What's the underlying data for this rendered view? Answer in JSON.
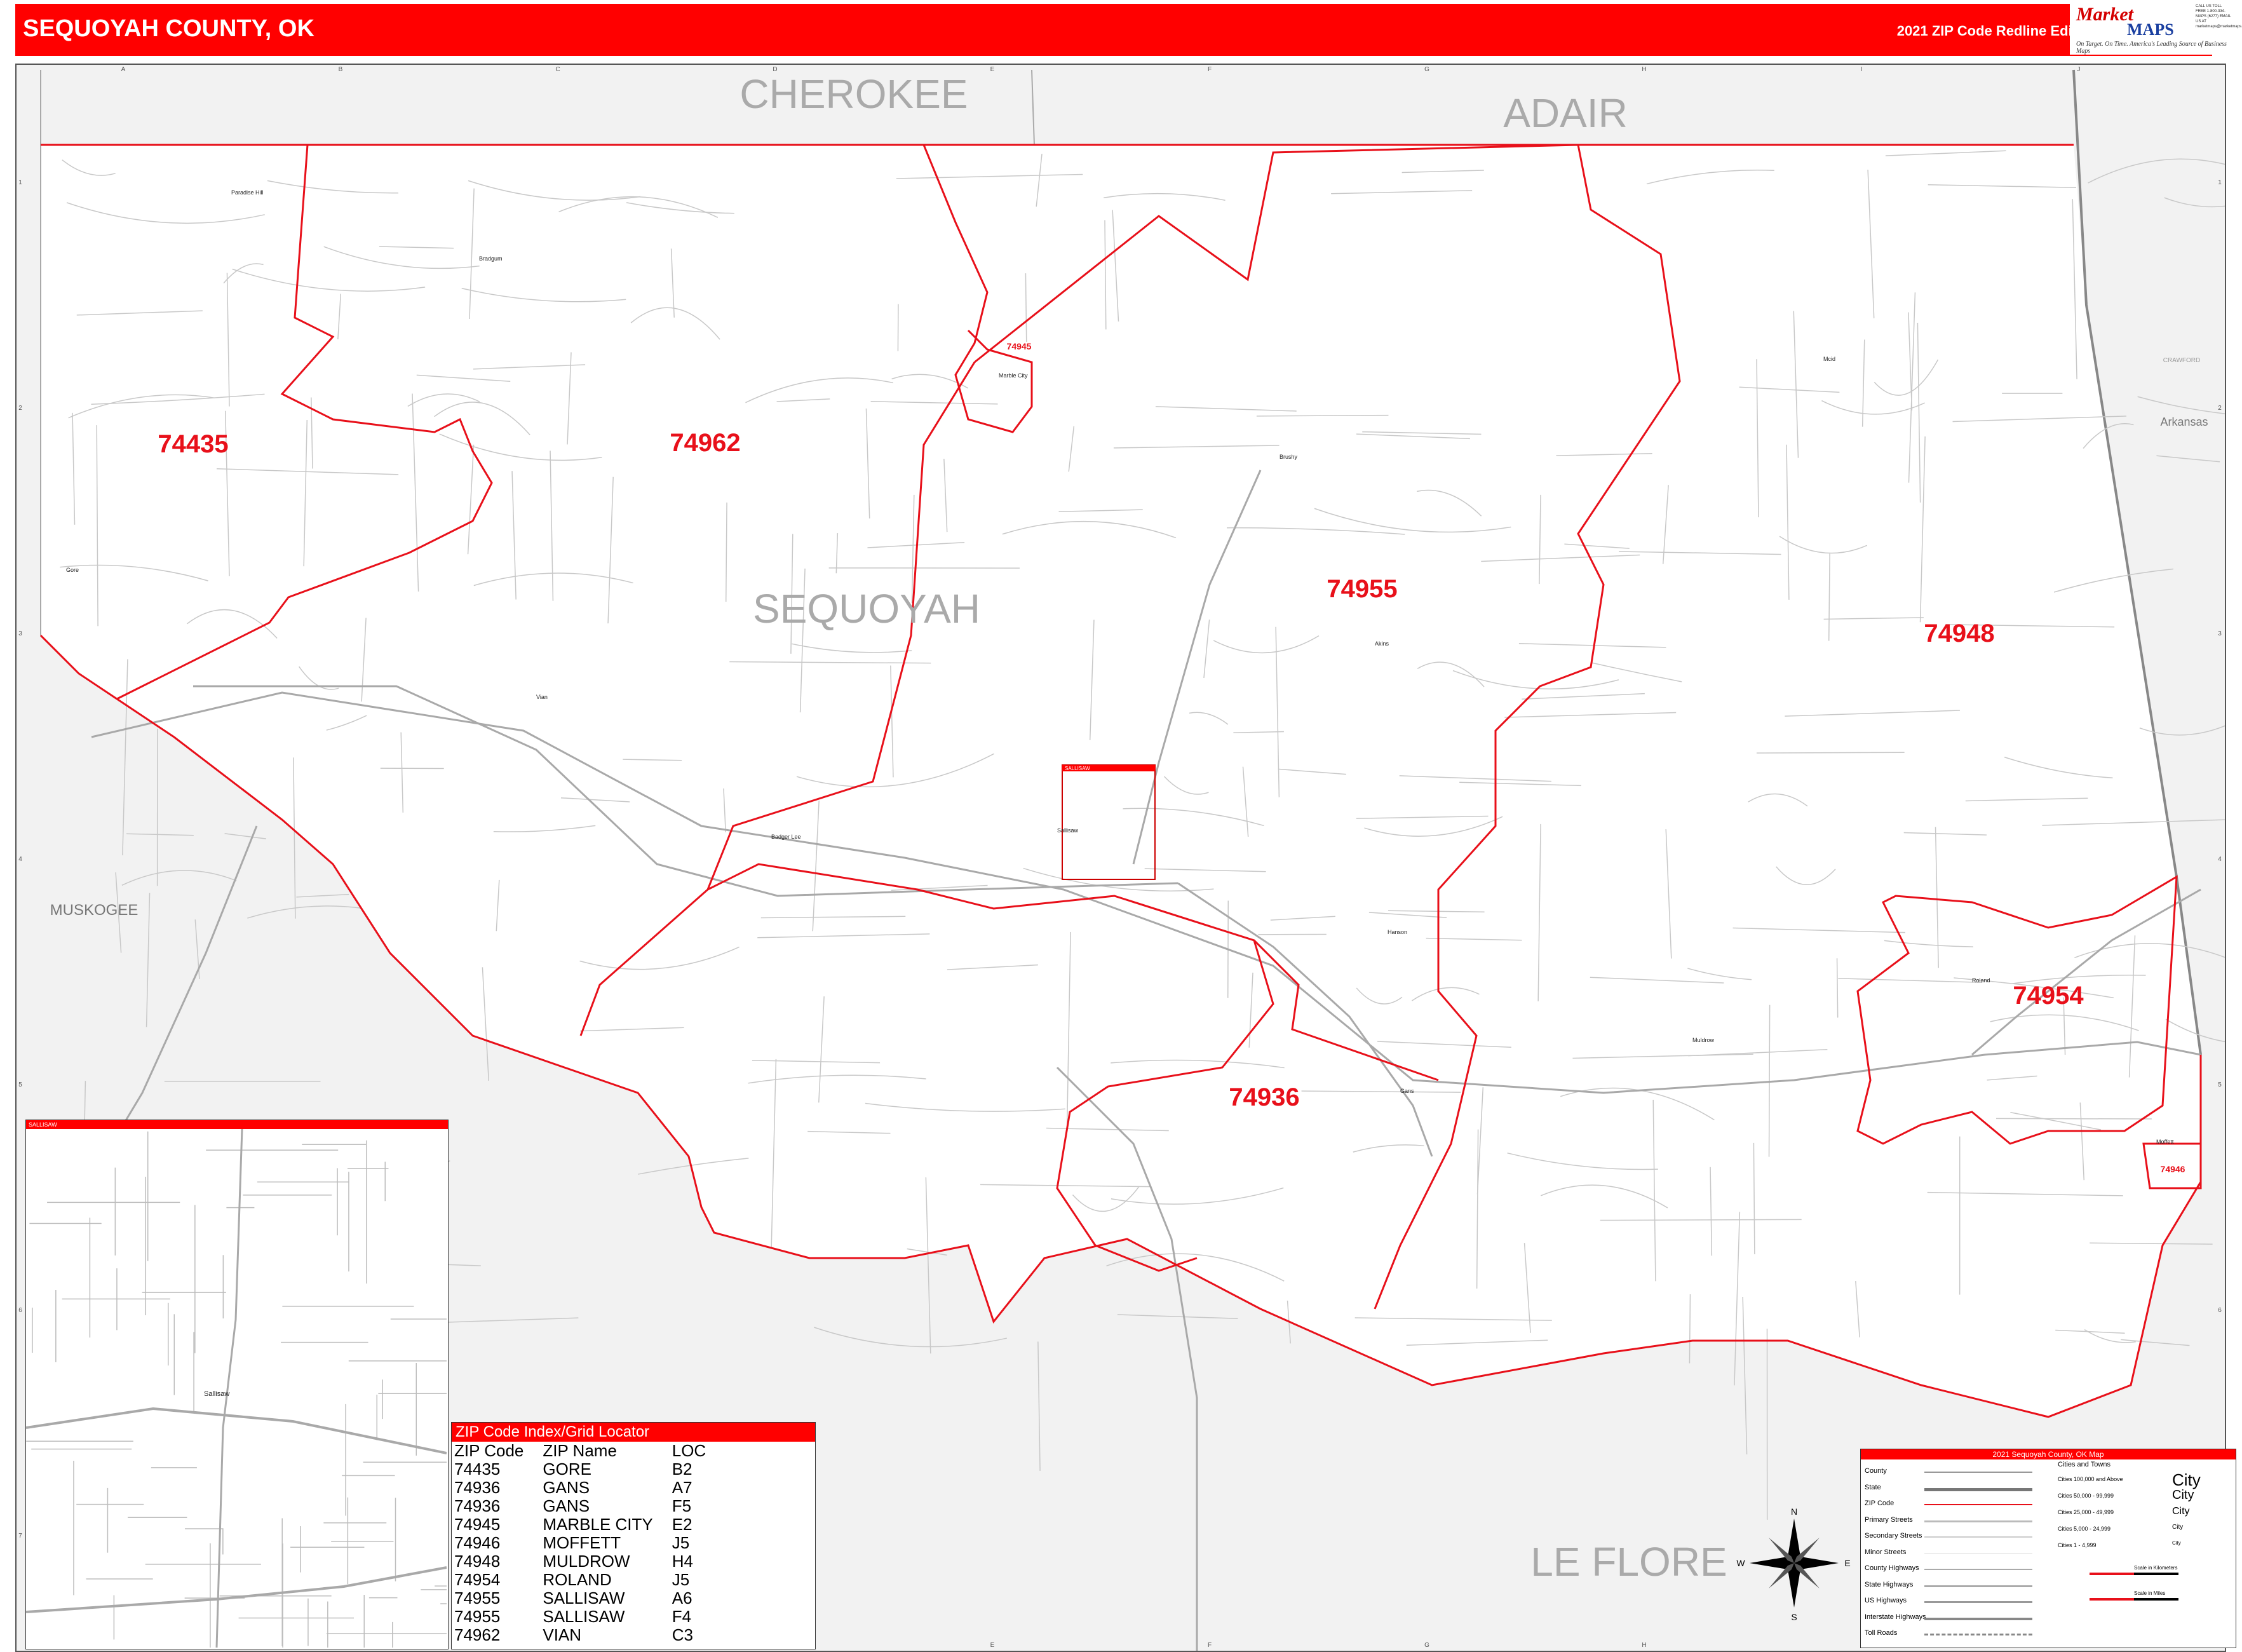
{
  "header": {
    "title": "SEQUOYAH COUNTY, OK",
    "edition": "2021 ZIP Code Redline Edition",
    "logo_line1": "Market",
    "logo_line2": "MAPS",
    "logo_tagline": "On Target. On Time. America's Leading Source of Business Maps",
    "logo_contact": "CALL US TOLL FREE 1-800-334-MAPS (6277) EMAIL US AT marketmaps@marketmaps.com"
  },
  "colors": {
    "header_bg": "#ff0000",
    "zip_boundary": "#e8101a",
    "zip_label": "#e8101a",
    "county_label": "#aaaaaa",
    "outside_fill": "#f2f2f2",
    "road": "#bdbdbd",
    "highway": "#aaaaaa"
  },
  "map": {
    "grid_columns": [
      "A",
      "B",
      "C",
      "D",
      "E",
      "F",
      "G",
      "H",
      "I",
      "J"
    ],
    "grid_rows": [
      "1",
      "2",
      "3",
      "4",
      "5",
      "6",
      "7"
    ],
    "counties": [
      {
        "name": "CHEROKEE",
        "id": "cherokee"
      },
      {
        "name": "ADAIR",
        "id": "adair"
      },
      {
        "name": "SEQUOYAH",
        "id": "sequoyah"
      },
      {
        "name": "LE FLORE",
        "id": "leflore"
      },
      {
        "name": "MUSKOGEE",
        "id": "muskogee"
      },
      {
        "name": "Arkansas",
        "id": "arkansas"
      },
      {
        "name": "CRAWFORD",
        "id": "crawford"
      }
    ],
    "zip_labels": [
      {
        "zip": "74435"
      },
      {
        "zip": "74962"
      },
      {
        "zip": "74955"
      },
      {
        "zip": "74948"
      },
      {
        "zip": "74954"
      },
      {
        "zip": "74936"
      },
      {
        "zip": "74945"
      },
      {
        "zip": "74946"
      }
    ],
    "cities": [
      "Paradise Hill",
      "Bradgum",
      "Gore",
      "Vian",
      "Marble City",
      "Brushy",
      "Sallisaw",
      "Akins",
      "Muldrow",
      "Roland",
      "Moffett",
      "Gans",
      "Hanson",
      "Mcid",
      "Badger Lee"
    ],
    "inset_box_label": "SALLISAW",
    "compass": {
      "n": "N",
      "s": "S",
      "e": "E",
      "w": "W"
    }
  },
  "inset": {
    "title": "SALLISAW",
    "city": "Sallisaw"
  },
  "zip_index": {
    "title": "ZIP Code Index/Grid Locator",
    "columns": [
      "ZIP Code",
      "ZIP Name",
      "LOC"
    ],
    "rows": [
      [
        "74435",
        "GORE",
        "B2"
      ],
      [
        "74936",
        "GANS",
        "A7"
      ],
      [
        "74936",
        "GANS",
        "F5"
      ],
      [
        "74945",
        "MARBLE CITY",
        "E2"
      ],
      [
        "74946",
        "MOFFETT",
        "J5"
      ],
      [
        "74948",
        "MULDROW",
        "H4"
      ],
      [
        "74954",
        "ROLAND",
        "J5"
      ],
      [
        "74955",
        "SALLISAW",
        "A6"
      ],
      [
        "74955",
        "SALLISAW",
        "F4"
      ],
      [
        "74962",
        "VIAN",
        "C3"
      ]
    ]
  },
  "legend": {
    "title": "2021 Sequoyah County, OK Map",
    "items": [
      "County",
      "State",
      "ZIP Code",
      "Primary Streets",
      "Secondary Streets",
      "Minor Streets",
      "County Highways",
      "State Highways",
      "US Highways",
      "Interstate Highways",
      "Toll Roads"
    ],
    "cities_title": "Cities and Towns",
    "city_classes": [
      "Cities 100,000 and Above",
      "Cities 50,000 - 99,999",
      "Cities 25,000 - 49,999",
      "Cities 5,000 - 24,999",
      "Cities 1 - 4,999"
    ],
    "city_samples": [
      "City",
      "City",
      "City",
      "City",
      "City"
    ],
    "scale_km": "Scale in Kilometers",
    "scale_mi": "Scale in Miles"
  }
}
